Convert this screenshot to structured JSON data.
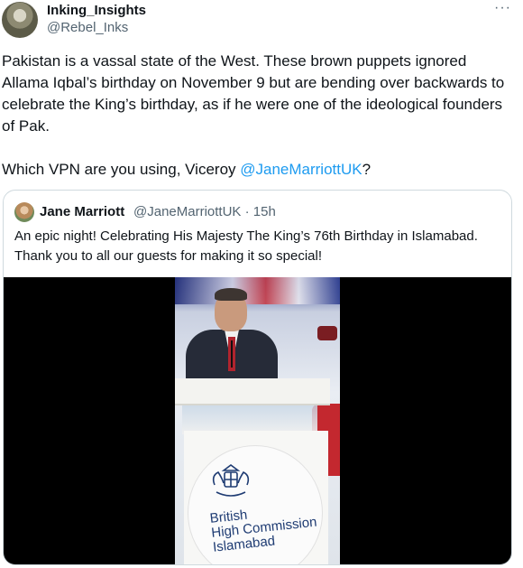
{
  "tweet": {
    "author": {
      "display_name": "Inking_Insights",
      "handle": "@Rebel_Inks"
    },
    "more_label": "···",
    "paragraph_1": "Pakistan is a vassal state of the West. These brown puppets ignored Allama Iqbal’s birthday on November 9 but are bending over backwards to celebrate the King’s birthday, as if he were one of the ideological founders of Pak.",
    "paragraph_2_prefix": "Which VPN are you using, Viceroy ",
    "paragraph_2_mention": "@JaneMarriottUK",
    "paragraph_2_suffix": "?"
  },
  "quoted_tweet": {
    "author": {
      "display_name": "Jane Marriott",
      "handle_time": "@JaneMarriottUK · 15h"
    },
    "text": "An epic night! Celebrating His Majesty The King’s 76th Birthday in Islamabad. Thank you to all our guests for making it so special!",
    "media": {
      "sign_line_1": "British",
      "sign_line_2": "High Commission",
      "sign_line_3": "Islamabad"
    }
  },
  "colors": {
    "link": "#1d9bf0",
    "text": "#0f1419",
    "secondary": "#536471",
    "border": "#cfd9de"
  },
  "icons": [
    "more-icon",
    "crest-icon"
  ]
}
